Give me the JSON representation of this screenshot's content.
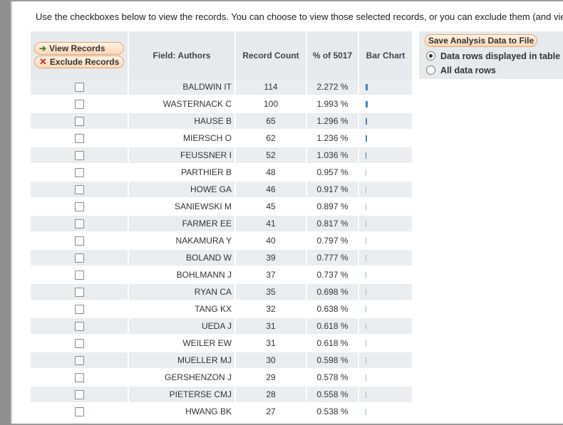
{
  "intro_text": "Use the checkboxes below to view the records. You can choose to view those selected records, or you can exclude them (and view the others).",
  "actions": {
    "view_records": "View Records",
    "exclude_records": "Exclude Records"
  },
  "columns": {
    "field": "Field: Authors",
    "record_count": "Record Count",
    "percent": "% of 5017",
    "bar_chart": "Bar Chart"
  },
  "right_panel": {
    "save_button": "Save Analysis Data to File",
    "radio_displayed": "Data rows displayed in table",
    "radio_all": "All data rows",
    "selected": "displayed"
  },
  "colors": {
    "bar": "#4a7ebb",
    "header_bg": "#e7eaed",
    "row_alt": "#e9edf0",
    "button_border": "#e3a36b"
  },
  "rows": [
    {
      "author": "BALDWIN IT",
      "count": "114",
      "percent": "2.272 %",
      "pct": 2.272
    },
    {
      "author": "WASTERNACK C",
      "count": "100",
      "percent": "1.993 %",
      "pct": 1.993
    },
    {
      "author": "HAUSE B",
      "count": "65",
      "percent": "1.296 %",
      "pct": 1.296
    },
    {
      "author": "MIERSCH O",
      "count": "62",
      "percent": "1.236 %",
      "pct": 1.236
    },
    {
      "author": "FEUSSNER I",
      "count": "52",
      "percent": "1.036 %",
      "pct": 1.036
    },
    {
      "author": "PARTHIER B",
      "count": "48",
      "percent": "0.957 %",
      "pct": 0.957
    },
    {
      "author": "HOWE GA",
      "count": "46",
      "percent": "0.917 %",
      "pct": 0.917
    },
    {
      "author": "SANIEWSKI M",
      "count": "45",
      "percent": "0.897 %",
      "pct": 0.897
    },
    {
      "author": "FARMER EE",
      "count": "41",
      "percent": "0.817 %",
      "pct": 0.817
    },
    {
      "author": "NAKAMURA Y",
      "count": "40",
      "percent": "0.797 %",
      "pct": 0.797
    },
    {
      "author": "BOLAND W",
      "count": "39",
      "percent": "0.777 %",
      "pct": 0.777
    },
    {
      "author": "BOHLMANN J",
      "count": "37",
      "percent": "0.737 %",
      "pct": 0.737
    },
    {
      "author": "RYAN CA",
      "count": "35",
      "percent": "0.698 %",
      "pct": 0.698
    },
    {
      "author": "TANG KX",
      "count": "32",
      "percent": "0.638 %",
      "pct": 0.638
    },
    {
      "author": "UEDA J",
      "count": "31",
      "percent": "0.618 %",
      "pct": 0.618
    },
    {
      "author": "WEILER EW",
      "count": "31",
      "percent": "0.618 %",
      "pct": 0.618
    },
    {
      "author": "MUELLER MJ",
      "count": "30",
      "percent": "0.598 %",
      "pct": 0.598
    },
    {
      "author": "GERSHENZON J",
      "count": "29",
      "percent": "0.578 %",
      "pct": 0.578
    },
    {
      "author": "PIETERSE CMJ",
      "count": "28",
      "percent": "0.558 %",
      "pct": 0.558
    },
    {
      "author": "HWANG BK",
      "count": "27",
      "percent": "0.538 %",
      "pct": 0.538
    }
  ]
}
